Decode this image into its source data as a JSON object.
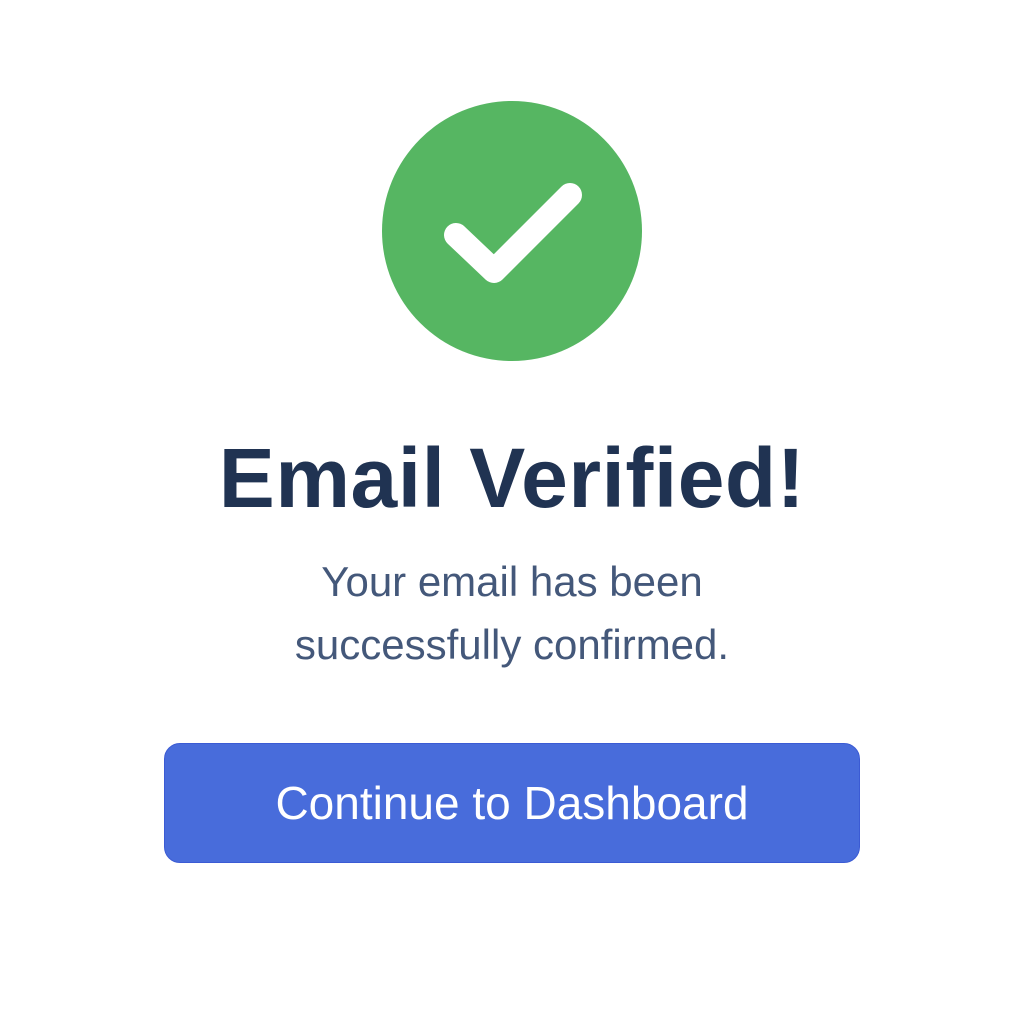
{
  "verification": {
    "status_icon": "checkmark-icon",
    "title": "Email Verified!",
    "message_line_1": "Your email has been",
    "message_line_2": "successfully confirmed.",
    "cta_label": "Continue to Dashboard"
  },
  "colors": {
    "success": "#56b662",
    "title": "#203352",
    "message": "#44587a",
    "button": "#486cdb",
    "button_text": "#ffffff",
    "background": "#ffffff"
  }
}
